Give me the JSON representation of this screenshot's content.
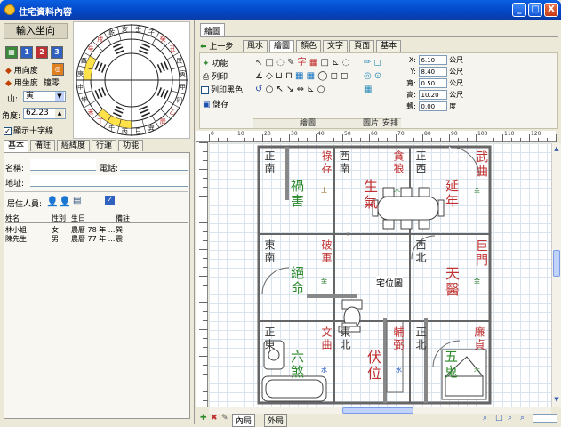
{
  "window": {
    "title": "住宅資料內容",
    "controls": [
      "_",
      "□",
      "X"
    ]
  },
  "left_panel": {
    "heading": "輸入坐向",
    "mode_buttons": [
      {
        "label": "用向度",
        "icon": "arrow-icon"
      },
      {
        "label": "用坐度",
        "icon": "arrow-icon"
      },
      {
        "label": "鐘零",
        "icon": ""
      }
    ],
    "mountain_label": "山:",
    "mountain_value": "寅",
    "angle_label": "角度:",
    "angle_value": "62.23",
    "show_cross_label": "顯示十字線",
    "show_cross_checked": true,
    "tabs": [
      "基本",
      "備註",
      "經緯度",
      "行運",
      "功能"
    ],
    "name_label": "名稱:",
    "phone_label": "電話:",
    "address_label": "地址:",
    "residents_label": "居住人員:",
    "table_headers": [
      "姓名",
      "性別",
      "生日",
      "備註"
    ],
    "table_rows": [
      [
        "林小姐",
        "女",
        "農曆 78 年 ...",
        "巽"
      ],
      [
        "陳先生",
        "男",
        "農曆 77 年 ...",
        "震"
      ]
    ]
  },
  "compass": {
    "rings_text": [
      "壬",
      "子",
      "癸",
      "丑",
      "艮",
      "寅",
      "甲",
      "卯",
      "乙",
      "辰",
      "巽",
      "巳",
      "丙",
      "午",
      "丁",
      "未",
      "坤",
      "申",
      "庚",
      "酉",
      "辛",
      "戌",
      "乾",
      "亥"
    ]
  },
  "right_panel": {
    "top_tab": "繪圖",
    "back_button": "上一步",
    "ribbon_tabs": [
      "風水",
      "繪圖",
      "顏色",
      "文字",
      "頁面",
      "基本"
    ],
    "active_ribbon_tab": "繪圖",
    "left_buttons": [
      "功能",
      "列印",
      "列印黑色",
      "儲存"
    ],
    "group_labels": [
      "繪圖",
      "圖片",
      "安排"
    ],
    "fields": [
      {
        "label": "X:",
        "value": "6.10",
        "unit": "公尺"
      },
      {
        "label": "Y:",
        "value": "8.40",
        "unit": "公尺"
      },
      {
        "label": "寬:",
        "value": "0.50",
        "unit": "公尺"
      },
      {
        "label": "高:",
        "value": "10.20",
        "unit": "公尺"
      },
      {
        "label": "轉:",
        "value": "0.00",
        "unit": "度"
      }
    ],
    "ruler_marks": [
      "0",
      "10",
      "20",
      "30",
      "40",
      "50",
      "60",
      "70",
      "80",
      "90",
      "100",
      "110",
      "120"
    ],
    "bottom_tabs": [
      "內局",
      "外局"
    ]
  },
  "floorplan": {
    "center_label": "宅位圖",
    "cells": [
      {
        "lines": [
          "正",
          "南"
        ],
        "color": "#333"
      },
      {
        "lines": [
          "祿",
          "存"
        ],
        "color": "#C03030"
      },
      {
        "lines": [
          "西",
          "南"
        ],
        "color": "#333"
      },
      {
        "lines": [
          "貪",
          "狼"
        ],
        "color": "#C03030"
      },
      {
        "lines": [
          "正",
          "西"
        ],
        "color": "#333"
      },
      {
        "lines": [
          "武",
          "曲"
        ],
        "color": "#C03030"
      },
      {
        "lines": [
          "禍",
          "害"
        ],
        "color": "#2E8B2E"
      },
      {
        "lines": [
          "生",
          "氣"
        ],
        "color": "#C03030"
      },
      {
        "lines": [
          "延",
          "年"
        ],
        "color": "#C03030"
      },
      {
        "lines": [
          "東",
          "南"
        ],
        "color": "#333"
      },
      {
        "lines": [
          "破",
          "軍"
        ],
        "color": "#C03030"
      },
      {
        "lines": [
          "西",
          "北"
        ],
        "color": "#333"
      },
      {
        "lines": [
          "巨",
          "門"
        ],
        "color": "#C03030"
      },
      {
        "lines": [
          "絕",
          "命"
        ],
        "color": "#2E8B2E"
      },
      {
        "lines": [
          "天",
          "醫"
        ],
        "color": "#C03030"
      },
      {
        "lines": [
          "正",
          "東"
        ],
        "color": "#333"
      },
      {
        "lines": [
          "文",
          "曲"
        ],
        "color": "#C03030"
      },
      {
        "lines": [
          "東",
          "北"
        ],
        "color": "#333"
      },
      {
        "lines": [
          "輔",
          "弼"
        ],
        "color": "#C03030"
      },
      {
        "lines": [
          "正",
          "北"
        ],
        "color": "#333"
      },
      {
        "lines": [
          "廉",
          "貞"
        ],
        "color": "#C03030"
      },
      {
        "lines": [
          "六",
          "煞"
        ],
        "color": "#2E8B2E"
      },
      {
        "lines": [
          "伏",
          "位"
        ],
        "color": "#C03030"
      },
      {
        "lines": [
          "五",
          "鬼"
        ],
        "color": "#2E8B2E"
      }
    ],
    "elements": [
      "土",
      "木",
      "金",
      "金",
      "金",
      "水",
      "水",
      "木",
      "水"
    ]
  }
}
